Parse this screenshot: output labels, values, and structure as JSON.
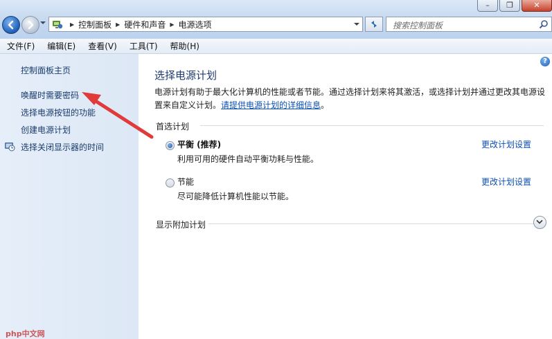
{
  "window": {
    "controls": {
      "minimize": "–",
      "maximize": "❐",
      "close": "✕"
    }
  },
  "address_bar": {
    "crumbs": [
      "控制面板",
      "硬件和声音",
      "电源选项"
    ]
  },
  "search": {
    "placeholder": "搜索控制面板"
  },
  "menu": [
    "文件(F)",
    "编辑(E)",
    "查看(V)",
    "工具(T)",
    "帮助(H)"
  ],
  "sidebar": {
    "items": [
      {
        "label": "控制面板主页"
      },
      {
        "label": "唤醒时需要密码"
      },
      {
        "label": "选择电源按钮的功能"
      },
      {
        "label": "创建电源计划"
      },
      {
        "label": "选择关闭显示器的时间",
        "icon": "clock-monitor-icon"
      }
    ]
  },
  "main": {
    "help_glyph": "?",
    "title": "选择电源计划",
    "description": "电源计划有助于最大化计算机的性能或者节能。通过选择计划来将其激活，或选择计划并通过更改其电源设置来自定义计划。",
    "description_link": "请提供电源计划的详细信息",
    "description_end": "。",
    "preferred_label": "首选计划",
    "plans": [
      {
        "name": "平衡 (推荐)",
        "desc": "利用可用的硬件自动平衡功耗与性能。",
        "selected": true,
        "link": "更改计划设置"
      },
      {
        "name": "节能",
        "desc": "尽可能降低计算机性能以节能。",
        "selected": false,
        "link": "更改计划设置"
      }
    ],
    "more_label": "显示附加计划"
  },
  "watermark": "php中文网",
  "colors": {
    "annotation": "#e03a3a",
    "link": "#0d4fb5",
    "sidebar_bg": "#e3edf8"
  }
}
